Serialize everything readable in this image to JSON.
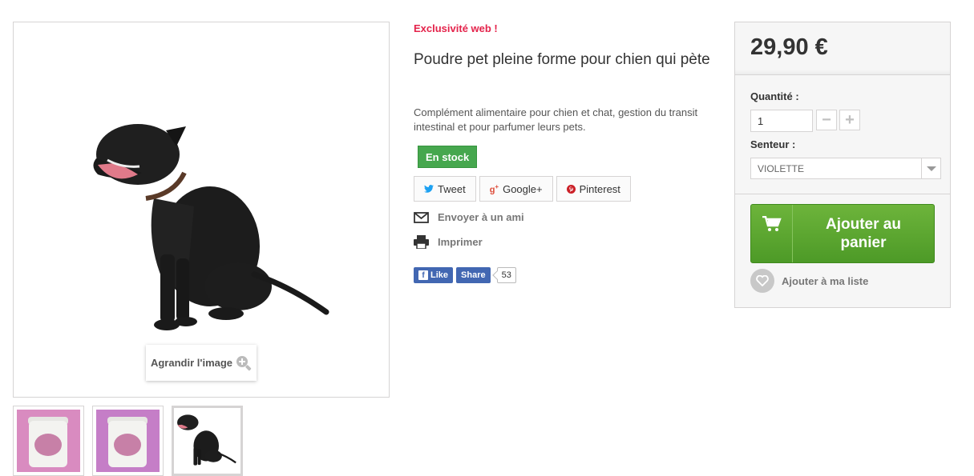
{
  "gallery": {
    "zoom_label": "Agrandir l'image",
    "thumbnails": [
      "jar-product-photo",
      "jar-product-photo",
      "dog-photo"
    ],
    "active_thumbnail": 3
  },
  "product": {
    "badge": "Exclusivité web !",
    "title": "Poudre pet pleine forme pour chien qui pète",
    "description": "Complément alimentaire pour chien et chat, gestion du transit intestinal et pour parfumer leurs pets.",
    "stock": "En stock"
  },
  "social": {
    "tweet": "Tweet",
    "google": "Google+",
    "pinterest": "Pinterest"
  },
  "actions": {
    "email": "Envoyer à un ami",
    "print": "Imprimer"
  },
  "facebook": {
    "like": "Like",
    "share": "Share",
    "count": "53"
  },
  "buybox": {
    "price": "29,90 €",
    "quantity_label": "Quantité :",
    "quantity_value": "1",
    "scent_label": "Senteur :",
    "scent_value": "VIOLETTE",
    "add_to_cart": "Ajouter au panier",
    "wishlist": "Ajouter à ma liste"
  },
  "colors": {
    "badge_red": "#e4234b",
    "stock_green": "#46a74e",
    "cart_green": "#5aa630",
    "facebook_blue": "#4267b2"
  }
}
